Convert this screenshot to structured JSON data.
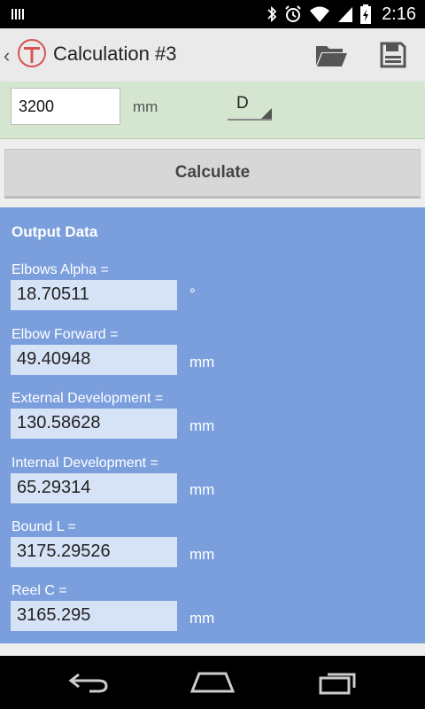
{
  "status_bar": {
    "time": "2:16",
    "icons": [
      "notification-icon",
      "bluetooth-icon",
      "alarm-icon",
      "wifi-icon",
      "signal-icon",
      "battery-icon"
    ]
  },
  "action_bar": {
    "title": "Calculation #3",
    "actions": [
      "folder-open-icon",
      "save-icon"
    ]
  },
  "input": {
    "length_value": "3200",
    "length_unit": "mm",
    "selector_value": "D"
  },
  "calculate_label": "Calculate",
  "output": {
    "title": "Output Data",
    "fields": [
      {
        "label": "Elbows Alpha =",
        "value": "18.70511",
        "unit": "°"
      },
      {
        "label": "Elbow Forward =",
        "value": "49.40948",
        "unit": "mm"
      },
      {
        "label": "External Development =",
        "value": "130.58628",
        "unit": "mm"
      },
      {
        "label": "Internal Development =",
        "value": "65.29314",
        "unit": "mm"
      },
      {
        "label": "Bound L =",
        "value": "3175.29526",
        "unit": "mm"
      },
      {
        "label": "Reel C =",
        "value": "3165.295",
        "unit": "mm"
      }
    ]
  },
  "colors": {
    "input_strip": "#d4e6d0",
    "output_panel": "#7b9fdd",
    "output_field": "#d6e2f6"
  },
  "nav_bar": [
    "back-icon",
    "home-icon",
    "recents-icon"
  ]
}
